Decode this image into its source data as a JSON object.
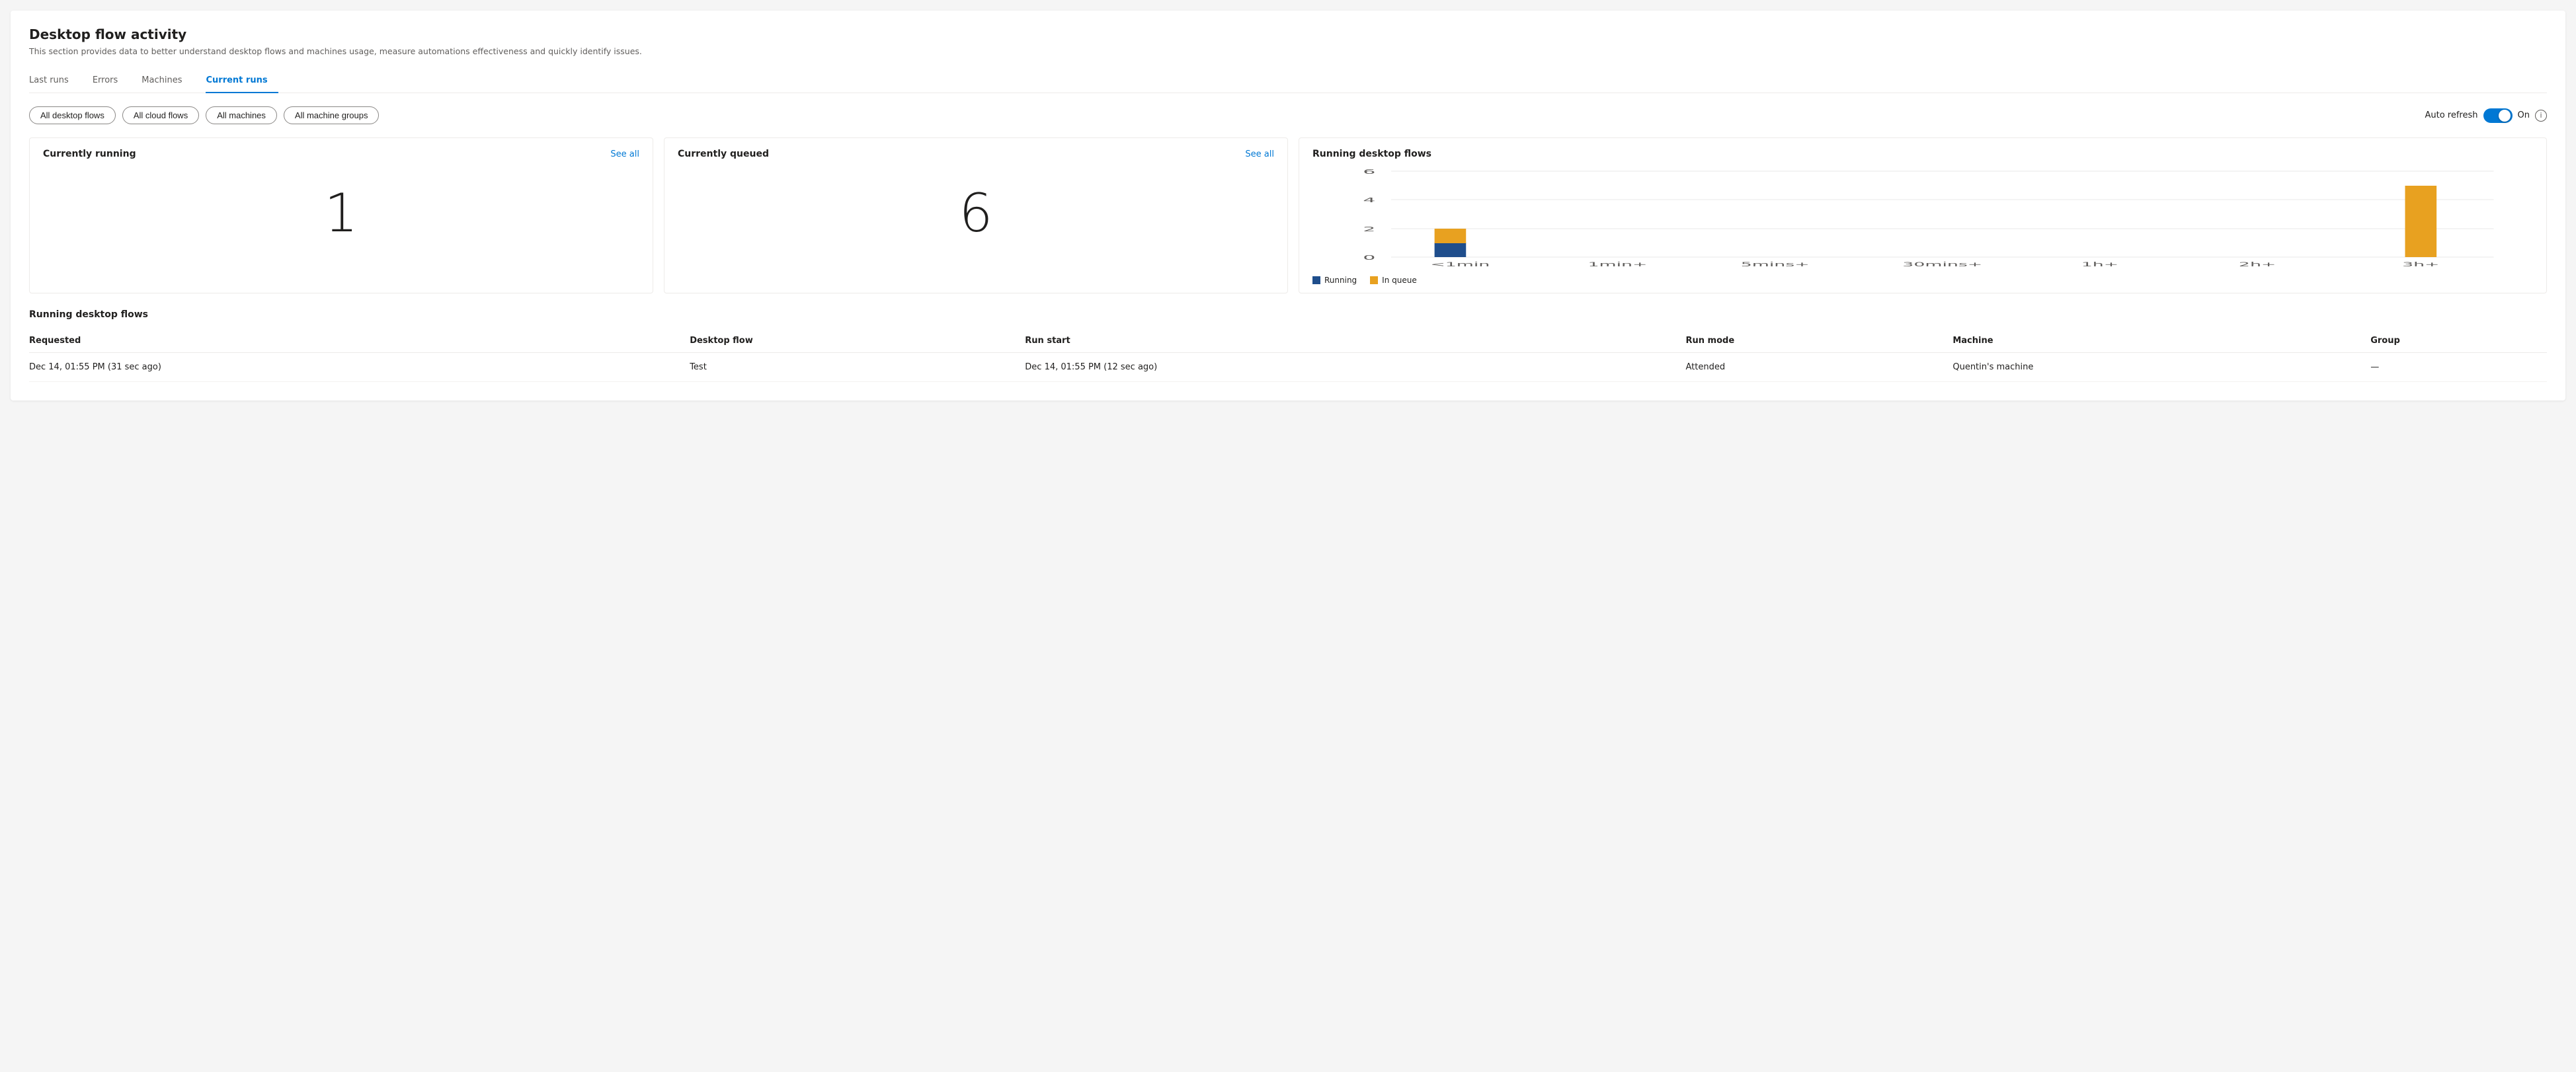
{
  "page": {
    "title": "Desktop flow activity",
    "subtitle": "This section provides data to better understand desktop flows and machines usage, measure automations effectiveness and quickly identify issues."
  },
  "tabs": [
    {
      "id": "last-runs",
      "label": "Last runs",
      "active": false
    },
    {
      "id": "errors",
      "label": "Errors",
      "active": false
    },
    {
      "id": "machines",
      "label": "Machines",
      "active": false
    },
    {
      "id": "current-runs",
      "label": "Current runs",
      "active": true
    }
  ],
  "filters": [
    {
      "id": "all-desktop-flows",
      "label": "All desktop flows"
    },
    {
      "id": "all-cloud-flows",
      "label": "All cloud flows"
    },
    {
      "id": "all-machines",
      "label": "All machines"
    },
    {
      "id": "all-machine-groups",
      "label": "All machine groups"
    }
  ],
  "auto_refresh": {
    "label": "Auto refresh",
    "status": "On"
  },
  "cards": {
    "currently_running": {
      "title": "Currently running",
      "see_all": "See all",
      "value": "1"
    },
    "currently_queued": {
      "title": "Currently queued",
      "see_all": "See all",
      "value": "6"
    },
    "running_desktop_flows_chart": {
      "title": "Running desktop flows",
      "x_labels": [
        "<1min",
        "1min+",
        "5mins+",
        "30mins+",
        "1h+",
        "2h+",
        "3h+"
      ],
      "running_values": [
        1,
        0,
        0,
        0,
        0,
        0,
        0
      ],
      "in_queue_values": [
        1,
        0,
        0,
        0,
        0,
        0,
        5
      ],
      "y_max": 6,
      "y_ticks": [
        0,
        2,
        4,
        6
      ],
      "legend": {
        "running_label": "Running",
        "in_queue_label": "In queue",
        "running_color": "#1f4e8c",
        "in_queue_color": "#e8a120"
      }
    }
  },
  "table": {
    "title": "Running desktop flows",
    "columns": [
      {
        "id": "requested",
        "label": "Requested"
      },
      {
        "id": "desktop-flow",
        "label": "Desktop flow"
      },
      {
        "id": "run-start",
        "label": "Run start"
      },
      {
        "id": "run-mode",
        "label": "Run mode"
      },
      {
        "id": "machine",
        "label": "Machine"
      },
      {
        "id": "group",
        "label": "Group"
      }
    ],
    "rows": [
      {
        "requested": "Dec 14, 01:55 PM (31 sec ago)",
        "desktop_flow": "Test",
        "run_start": "Dec 14, 01:55 PM (12 sec ago)",
        "run_mode": "Attended",
        "machine": "Quentin's machine",
        "group": "—"
      }
    ]
  }
}
